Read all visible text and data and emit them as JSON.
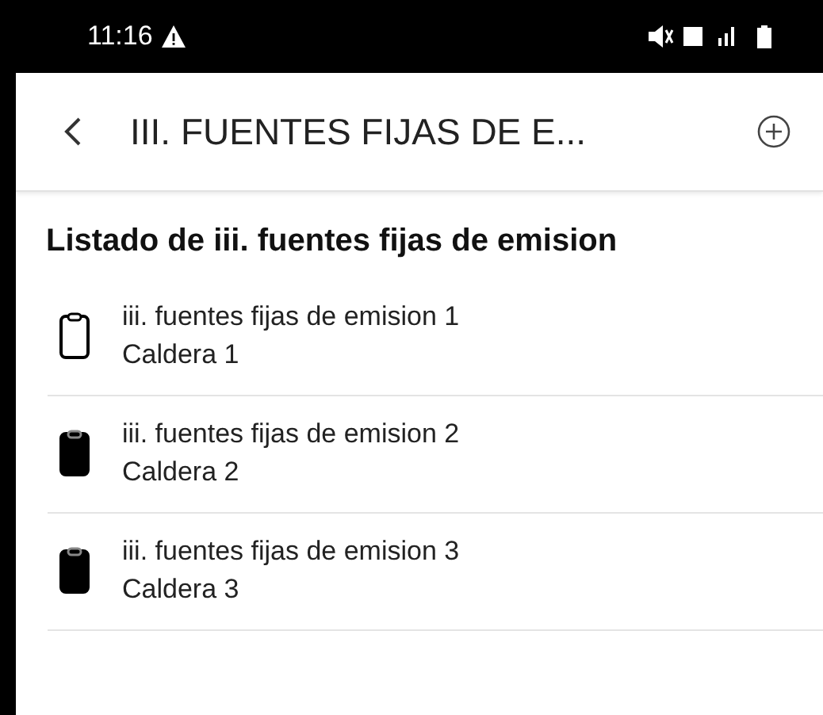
{
  "status_bar": {
    "time": "11:16"
  },
  "app_bar": {
    "title": "III. FUENTES FIJAS DE E..."
  },
  "list": {
    "heading": "Listado de iii. fuentes fijas de emision",
    "items": [
      {
        "title": "iii. fuentes fijas de emision 1",
        "subtitle": "Caldera 1",
        "filled": false
      },
      {
        "title": "iii. fuentes fijas de emision 2",
        "subtitle": "Caldera 2",
        "filled": true
      },
      {
        "title": "iii. fuentes fijas de emision 3",
        "subtitle": "Caldera 3",
        "filled": true
      }
    ]
  }
}
